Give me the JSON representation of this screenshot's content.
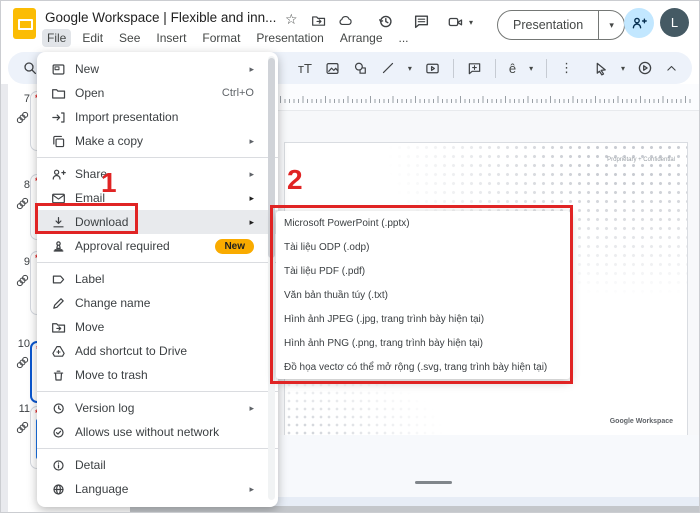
{
  "titlebar": {
    "title": "Google Workspace | Flexible and inn...",
    "present_label": "Presentation",
    "avatar_initial": "L"
  },
  "menubar": {
    "items": [
      {
        "label": "File",
        "active": true
      },
      {
        "label": "Edit"
      },
      {
        "label": "See"
      },
      {
        "label": "Insert"
      },
      {
        "label": "Format"
      },
      {
        "label": "Presentation"
      },
      {
        "label": "Arrange"
      },
      {
        "label": "..."
      }
    ]
  },
  "icons": {
    "star": "☆",
    "caret": "▾",
    "submenu_arrow": "▸",
    "more": "⋮",
    "textbox": "ᴛT",
    "theme_letter": "ê"
  },
  "file_menu": {
    "items": [
      {
        "label": "New",
        "icon": "new-presentation-icon",
        "submenu": true
      },
      {
        "label": "Open",
        "icon": "open-folder-icon",
        "shortcut": "Ctrl+O"
      },
      {
        "label": "Import presentation",
        "icon": "import-icon"
      },
      {
        "label": "Make a copy",
        "icon": "copy-icon",
        "submenu": true
      },
      {
        "type": "divider"
      },
      {
        "label": "Share",
        "icon": "share-person-icon",
        "submenu": true
      },
      {
        "label": "Email",
        "icon": "email-icon",
        "submenu": true
      },
      {
        "label": "Download",
        "icon": "download-icon",
        "submenu": true,
        "highlighted": true
      },
      {
        "label": "Approval required",
        "icon": "approval-stamp-icon",
        "badge": "New"
      },
      {
        "type": "divider"
      },
      {
        "label": "Label",
        "icon": "label-tag-icon"
      },
      {
        "label": "Change name",
        "icon": "rename-pencil-icon"
      },
      {
        "label": "Move",
        "icon": "move-folder-icon"
      },
      {
        "label": "Add shortcut to Drive",
        "icon": "drive-shortcut-icon"
      },
      {
        "label": "Move to trash",
        "icon": "trash-icon"
      },
      {
        "type": "divider"
      },
      {
        "label": "Version log",
        "icon": "version-history-icon",
        "submenu": true
      },
      {
        "label": "Allows use without network",
        "icon": "offline-icon"
      },
      {
        "type": "divider"
      },
      {
        "label": "Detail",
        "icon": "info-icon"
      },
      {
        "label": "Language",
        "icon": "language-globe-icon",
        "submenu": true
      }
    ]
  },
  "download_submenu": {
    "items": [
      "Microsoft PowerPoint (.pptx)",
      "Tài liệu ODP (.odp)",
      "Tài liệu PDF (.pdf)",
      "Văn bản thuần túy (.txt)",
      "Hình ảnh JPEG (.jpg, trang trình bày hiện tại)",
      "Hình ảnh PNG (.png, trang trình bày hiện tại)",
      "Đồ họa vectơ có thể mở rộng (.svg, trang trình bày hiện tại)"
    ]
  },
  "filmstrip": {
    "slides": [
      {
        "number": "7"
      },
      {
        "number": "8"
      },
      {
        "number": "9"
      },
      {
        "number": "10",
        "selected": true
      },
      {
        "number": "11"
      }
    ]
  },
  "slide": {
    "header_note": "Proprietary + Confidential",
    "brand": "Google Workspace"
  },
  "annotations": {
    "step1": "1",
    "step2": "2",
    "color": "#e02424"
  },
  "colors": {
    "annotation_red": "#e02424",
    "badge_gold": "#F9AB00",
    "selection_blue": "#0b57d0",
    "share_button_bg": "#c2e7ff",
    "toolbar_bg": "#edf2fa"
  }
}
